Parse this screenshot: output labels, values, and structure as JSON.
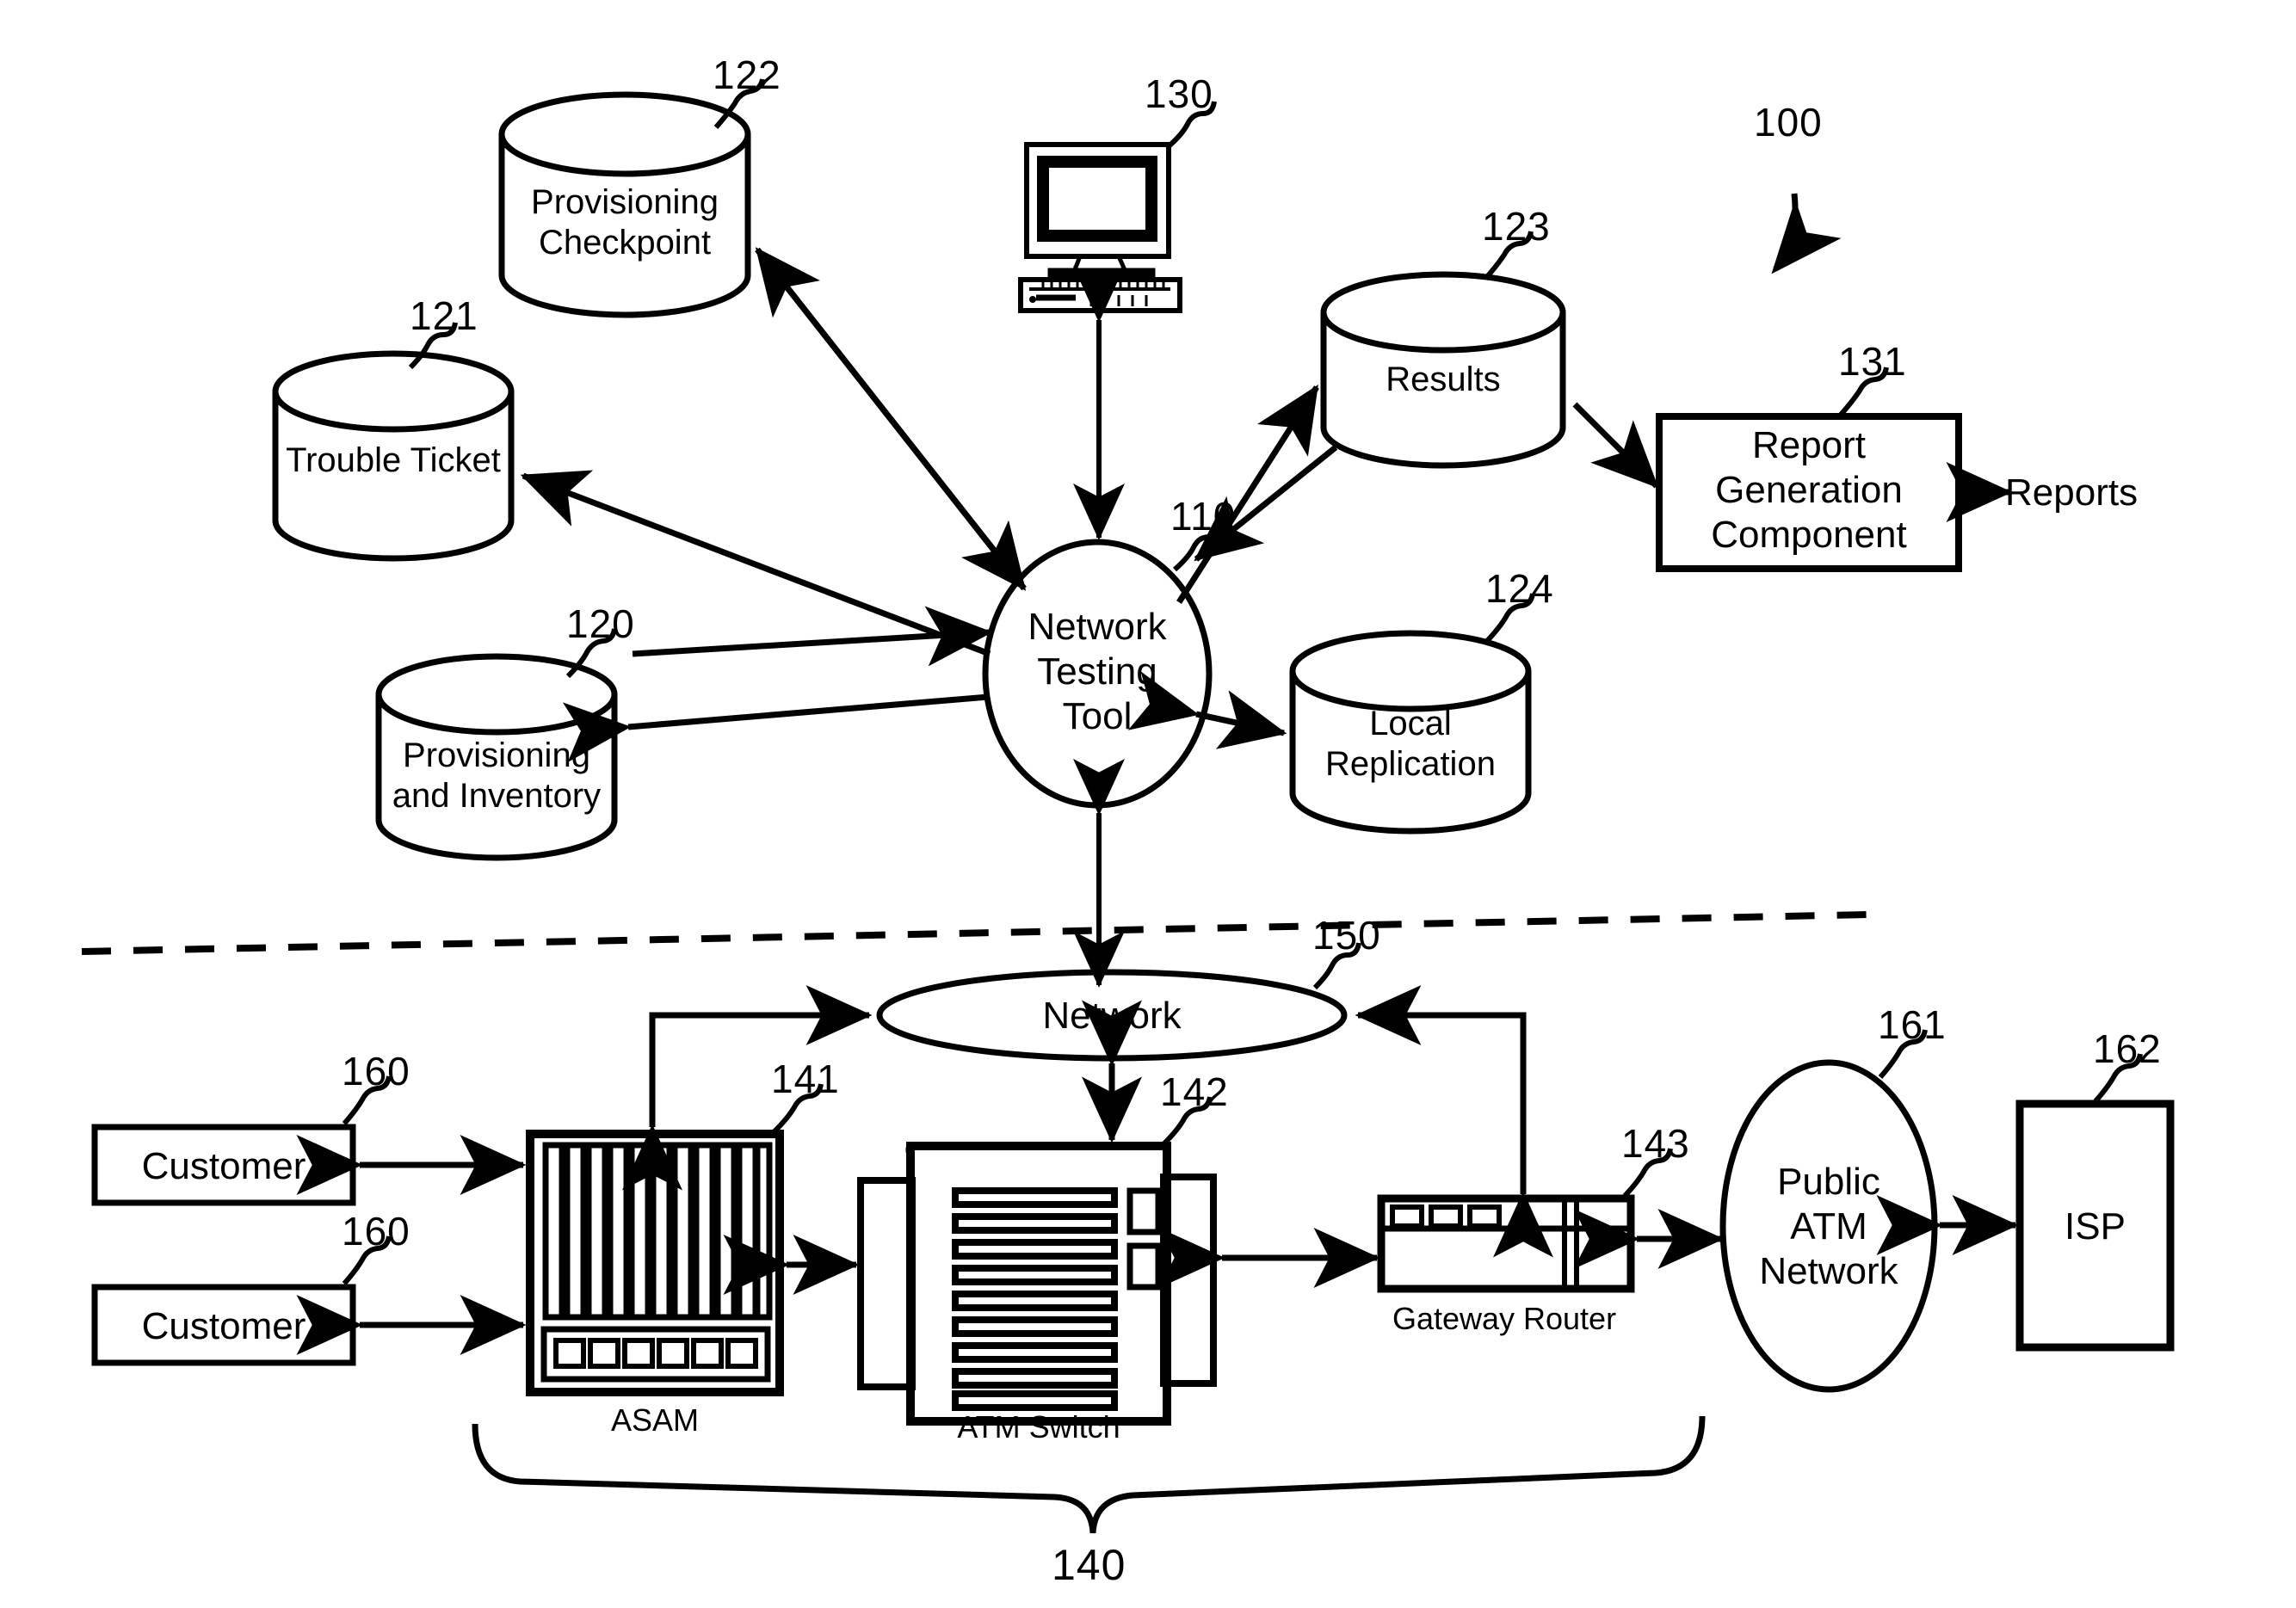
{
  "figure": {
    "overall_ref": "100",
    "domain": "patent-network-diagram"
  },
  "upper_section": {
    "central_node": {
      "label": "Network\nTesting\nTool",
      "ref": "110",
      "shape": "ellipse"
    },
    "terminal": {
      "label": "",
      "ref": "130",
      "shape": "workstation-icon"
    },
    "datastores": [
      {
        "label": "Provisioning\nCheckpoint",
        "ref": "122",
        "shape": "cylinder"
      },
      {
        "label": "Trouble Ticket",
        "ref": "121",
        "shape": "cylinder"
      },
      {
        "label": "Provisioning\nand Inventory",
        "ref": "120",
        "shape": "cylinder"
      },
      {
        "label": "Results",
        "ref": "123",
        "shape": "cylinder"
      },
      {
        "label": "Local\nReplication",
        "ref": "124",
        "shape": "cylinder"
      }
    ],
    "report_component": {
      "label": "Report\nGeneration\nComponent",
      "ref": "131",
      "shape": "rect"
    },
    "report_output": {
      "label": "Reports"
    }
  },
  "lower_section": {
    "network": {
      "label": "Network",
      "ref": "150",
      "shape": "ellipse"
    },
    "customers": [
      {
        "label": "Customer",
        "ref": "160"
      },
      {
        "label": "Customer",
        "ref": "160"
      }
    ],
    "equipment": [
      {
        "label": "ASAM",
        "ref": "141",
        "shape": "shelf-card-rack"
      },
      {
        "label": "ATM Switch",
        "ref": "142",
        "shape": "switch-chassis"
      },
      {
        "label": "Gateway Router",
        "ref": "143",
        "shape": "router-box"
      }
    ],
    "group_brace_ref": "140",
    "public_network": {
      "label": "Public\nATM\nNetwork",
      "ref": "161",
      "shape": "ellipse"
    },
    "isp": {
      "label": "ISP",
      "ref": "162",
      "shape": "rect"
    }
  }
}
